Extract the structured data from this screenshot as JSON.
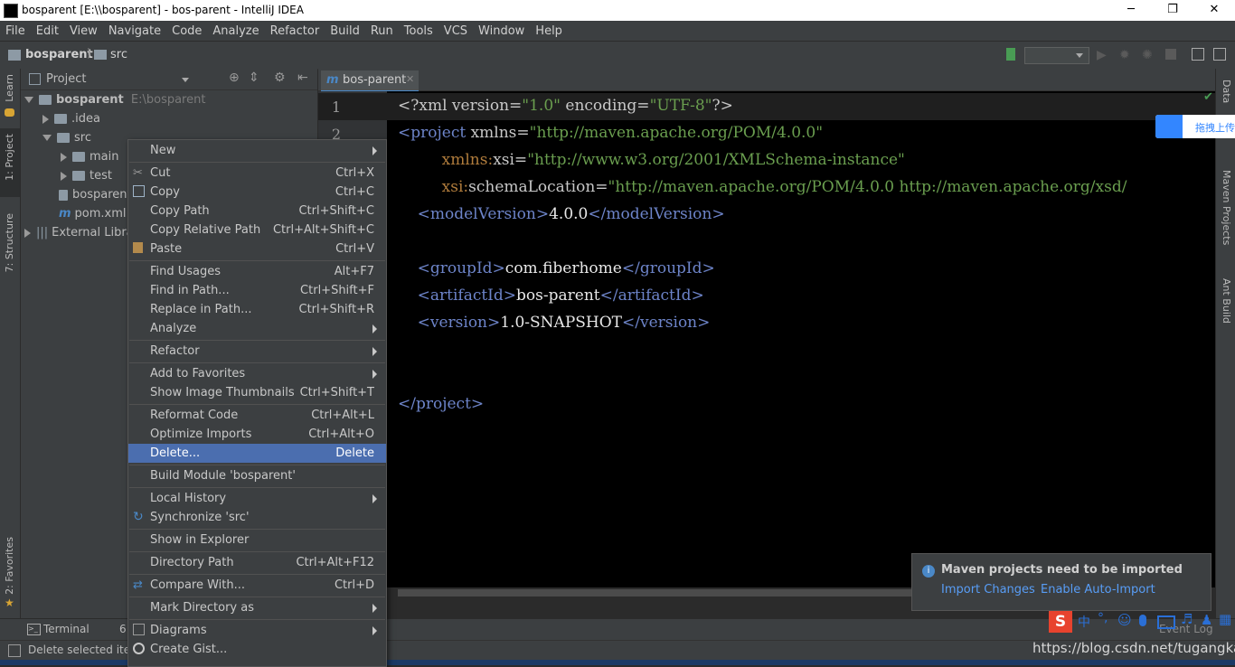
{
  "window": {
    "title": "bosparent [E:\\\\bosparent] - bos-parent - IntelliJ IDEA",
    "minimize": "─",
    "maximize": "❐",
    "close": "✕"
  },
  "menubar": [
    "File",
    "Edit",
    "View",
    "Navigate",
    "Code",
    "Analyze",
    "Refactor",
    "Build",
    "Run",
    "Tools",
    "VCS",
    "Window",
    "Help"
  ],
  "navbar": {
    "project": "bosparent",
    "folder": "src"
  },
  "left_strip": {
    "learn": "Learn",
    "project": "1: Project",
    "structure": "7: Structure",
    "favorites": "2: Favorites"
  },
  "right_strip": {
    "data": "Data",
    "maven": "Maven Projects",
    "ant": "Ant Build"
  },
  "project_panel": {
    "title": "Project",
    "tree": [
      {
        "label": "bosparent",
        "path": "E:\\bosparent"
      },
      {
        "label": ".idea"
      },
      {
        "label": "src"
      },
      {
        "label": "main"
      },
      {
        "label": "test"
      },
      {
        "label": "bosparent"
      },
      {
        "label": "pom.xml"
      },
      {
        "label": "External Libra"
      }
    ]
  },
  "editor": {
    "tab": "bos-parent",
    "line_numbers": [
      "1",
      "2"
    ]
  },
  "context_menu": [
    {
      "label": "New",
      "shortcut": ""
    },
    {
      "label": "Cut",
      "shortcut": "Ctrl+X"
    },
    {
      "label": "Copy",
      "shortcut": "Ctrl+C"
    },
    {
      "label": "Copy Path",
      "shortcut": "Ctrl+Shift+C"
    },
    {
      "label": "Copy Relative Path",
      "shortcut": "Ctrl+Alt+Shift+C"
    },
    {
      "label": "Paste",
      "shortcut": "Ctrl+V"
    },
    {
      "label": "Find Usages",
      "shortcut": "Alt+F7"
    },
    {
      "label": "Find in Path...",
      "shortcut": "Ctrl+Shift+F"
    },
    {
      "label": "Replace in Path...",
      "shortcut": "Ctrl+Shift+R"
    },
    {
      "label": "Analyze",
      "shortcut": ""
    },
    {
      "label": "Refactor",
      "shortcut": ""
    },
    {
      "label": "Add to Favorites",
      "shortcut": ""
    },
    {
      "label": "Show Image Thumbnails",
      "shortcut": "Ctrl+Shift+T"
    },
    {
      "label": "Reformat Code",
      "shortcut": "Ctrl+Alt+L"
    },
    {
      "label": "Optimize Imports",
      "shortcut": "Ctrl+Alt+O"
    },
    {
      "label": "Delete...",
      "shortcut": "Delete"
    },
    {
      "label": "Build Module 'bosparent'",
      "shortcut": ""
    },
    {
      "label": "Local History",
      "shortcut": ""
    },
    {
      "label": "Synchronize 'src'",
      "shortcut": ""
    },
    {
      "label": "Show in Explorer",
      "shortcut": ""
    },
    {
      "label": "Directory Path",
      "shortcut": "Ctrl+Alt+F12"
    },
    {
      "label": "Compare With...",
      "shortcut": "Ctrl+D"
    },
    {
      "label": "Mark Directory as",
      "shortcut": ""
    },
    {
      "label": "Diagrams",
      "shortcut": ""
    },
    {
      "label": "Create Gist...",
      "shortcut": ""
    }
  ],
  "notification": {
    "title": "Maven projects need to be imported",
    "import": "Import Changes",
    "auto": "Enable Auto-Import"
  },
  "bottom": {
    "terminal": "Terminal",
    "tab6": "6:",
    "status": "Delete selected iter",
    "event_log": "Event Log"
  },
  "baidu": {
    "label": "拖拽上传"
  },
  "ime": {
    "chinese": "中"
  },
  "watermark": "https://blog.csdn.net/tugangkai",
  "colors": {
    "accent": "#4b6eaf",
    "link": "#589df6",
    "tag": "#6d84c9",
    "string": "#6a9e4f"
  }
}
